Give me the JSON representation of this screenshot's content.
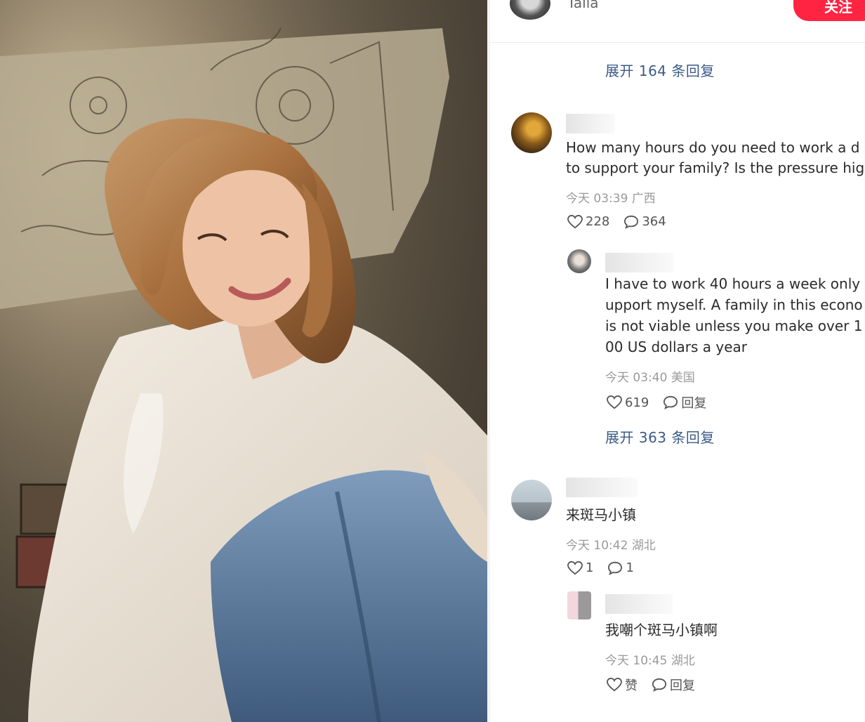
{
  "header": {
    "username": "Talia",
    "follow_label": "关注"
  },
  "thread": {
    "expand_1": "展开 164 条回复",
    "expand_2": "展开 363 条回复"
  },
  "comments": [
    {
      "text_lines": [
        "How many hours do you need to work a d",
        "to support your family? Is the pressure hig"
      ],
      "time": "今天 03:39",
      "location": "广西",
      "likes": "228",
      "replies": "364"
    },
    {
      "text_lines": [
        "I have to work 40 hours a week only",
        "upport myself. A family in this econo",
        "is not viable unless you make over 1",
        "00 US dollars a year"
      ],
      "time": "今天 03:40",
      "location": "美国",
      "likes": "619",
      "reply_label": "回复"
    },
    {
      "text_lines": [
        "来斑马小镇"
      ],
      "time": "今天 10:42",
      "location": "湖北",
      "likes": "1",
      "replies": "1"
    },
    {
      "text_lines": [
        "我嘲个斑马小镇啊"
      ],
      "time": "今天 10:45",
      "location": "湖北",
      "like_label": "赞",
      "reply_label": "回复"
    }
  ],
  "icons": {
    "like": "heart-icon",
    "reply": "speech-bubble-icon"
  },
  "colors": {
    "follow_button": "#ff2442",
    "expand_link": "#3b5a88",
    "meta_text": "#9a9a9a"
  }
}
